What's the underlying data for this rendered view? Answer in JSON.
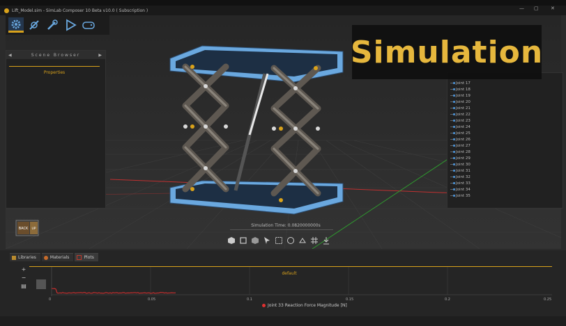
{
  "window": {
    "title": "Lift_Model.sim - SimLab Composer 10 Beta v10.0 ( Subscription )",
    "controls": [
      "—",
      "▢",
      "✕"
    ]
  },
  "toolbar": {
    "tools": [
      {
        "name": "settings-tool",
        "icon": "gear-icon",
        "active": true
      },
      {
        "name": "mechanics-tool",
        "icon": "joint-icon"
      },
      {
        "name": "tools-tool",
        "icon": "wrench-icon"
      },
      {
        "name": "play-tool",
        "icon": "play-icon"
      },
      {
        "name": "game-tool",
        "icon": "gamepad-icon"
      }
    ]
  },
  "scene_browser": {
    "title": "Scene Browser",
    "properties_label": "Properties"
  },
  "joint_list": [
    "Joint 17",
    "Joint 18",
    "Joint 19",
    "Joint 20",
    "Joint 21",
    "Joint 22",
    "Joint 23",
    "Joint 24",
    "Joint 25",
    "Joint 26",
    "Joint 27",
    "Joint 28",
    "Joint 29",
    "Joint 30",
    "Joint 31",
    "Joint 32",
    "Joint 33",
    "Joint 34",
    "Joint 35"
  ],
  "banner": {
    "text": "Simulation"
  },
  "view_cube": {
    "left_label": "BACK",
    "right_label": "UP"
  },
  "simulation": {
    "time_label": "Simulation Time: 0.0820000000s"
  },
  "bottom_tabs": [
    {
      "label": "Libraries",
      "icon": "library-icon"
    },
    {
      "label": "Materials",
      "icon": "palette-icon"
    },
    {
      "label": "Plots",
      "icon": "plot-icon",
      "active": true
    }
  ],
  "plot": {
    "title": "default",
    "x_ticks": [
      "0",
      "0.05",
      "0.1",
      "0.15",
      "0.2",
      "0.25"
    ],
    "legend": "Joint 33 Reaction Force Magnitude [N]",
    "side_tools": [
      "+",
      "−"
    ]
  },
  "colors": {
    "accent": "#d9a21b",
    "platform": "#6aa8df",
    "link": "#706a62",
    "legend": "#e03030"
  }
}
